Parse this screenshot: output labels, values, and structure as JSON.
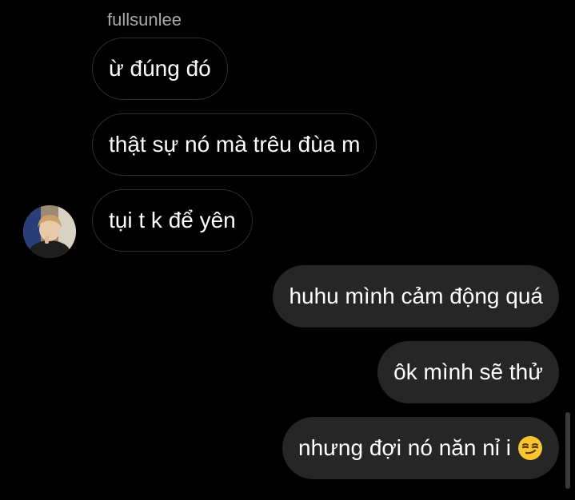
{
  "conversation": {
    "sender": "fullsunlee",
    "incoming": [
      {
        "text": "ừ đúng đó"
      },
      {
        "text": "thật sự nó mà trêu đùa m"
      },
      {
        "text": "tụi t k để yên"
      }
    ],
    "outgoing": [
      {
        "text": "huhu mình cảm động quá"
      },
      {
        "text": "ôk mình sẽ thử"
      },
      {
        "text": "nhưng đợi nó năn nỉ i",
        "emoji": "smirking-face-emoji"
      }
    ]
  },
  "colors": {
    "background": "#000000",
    "outgoing_bubble": "#262626",
    "incoming_border": "#2f2f2f",
    "sender_name": "#a8a8a8"
  }
}
